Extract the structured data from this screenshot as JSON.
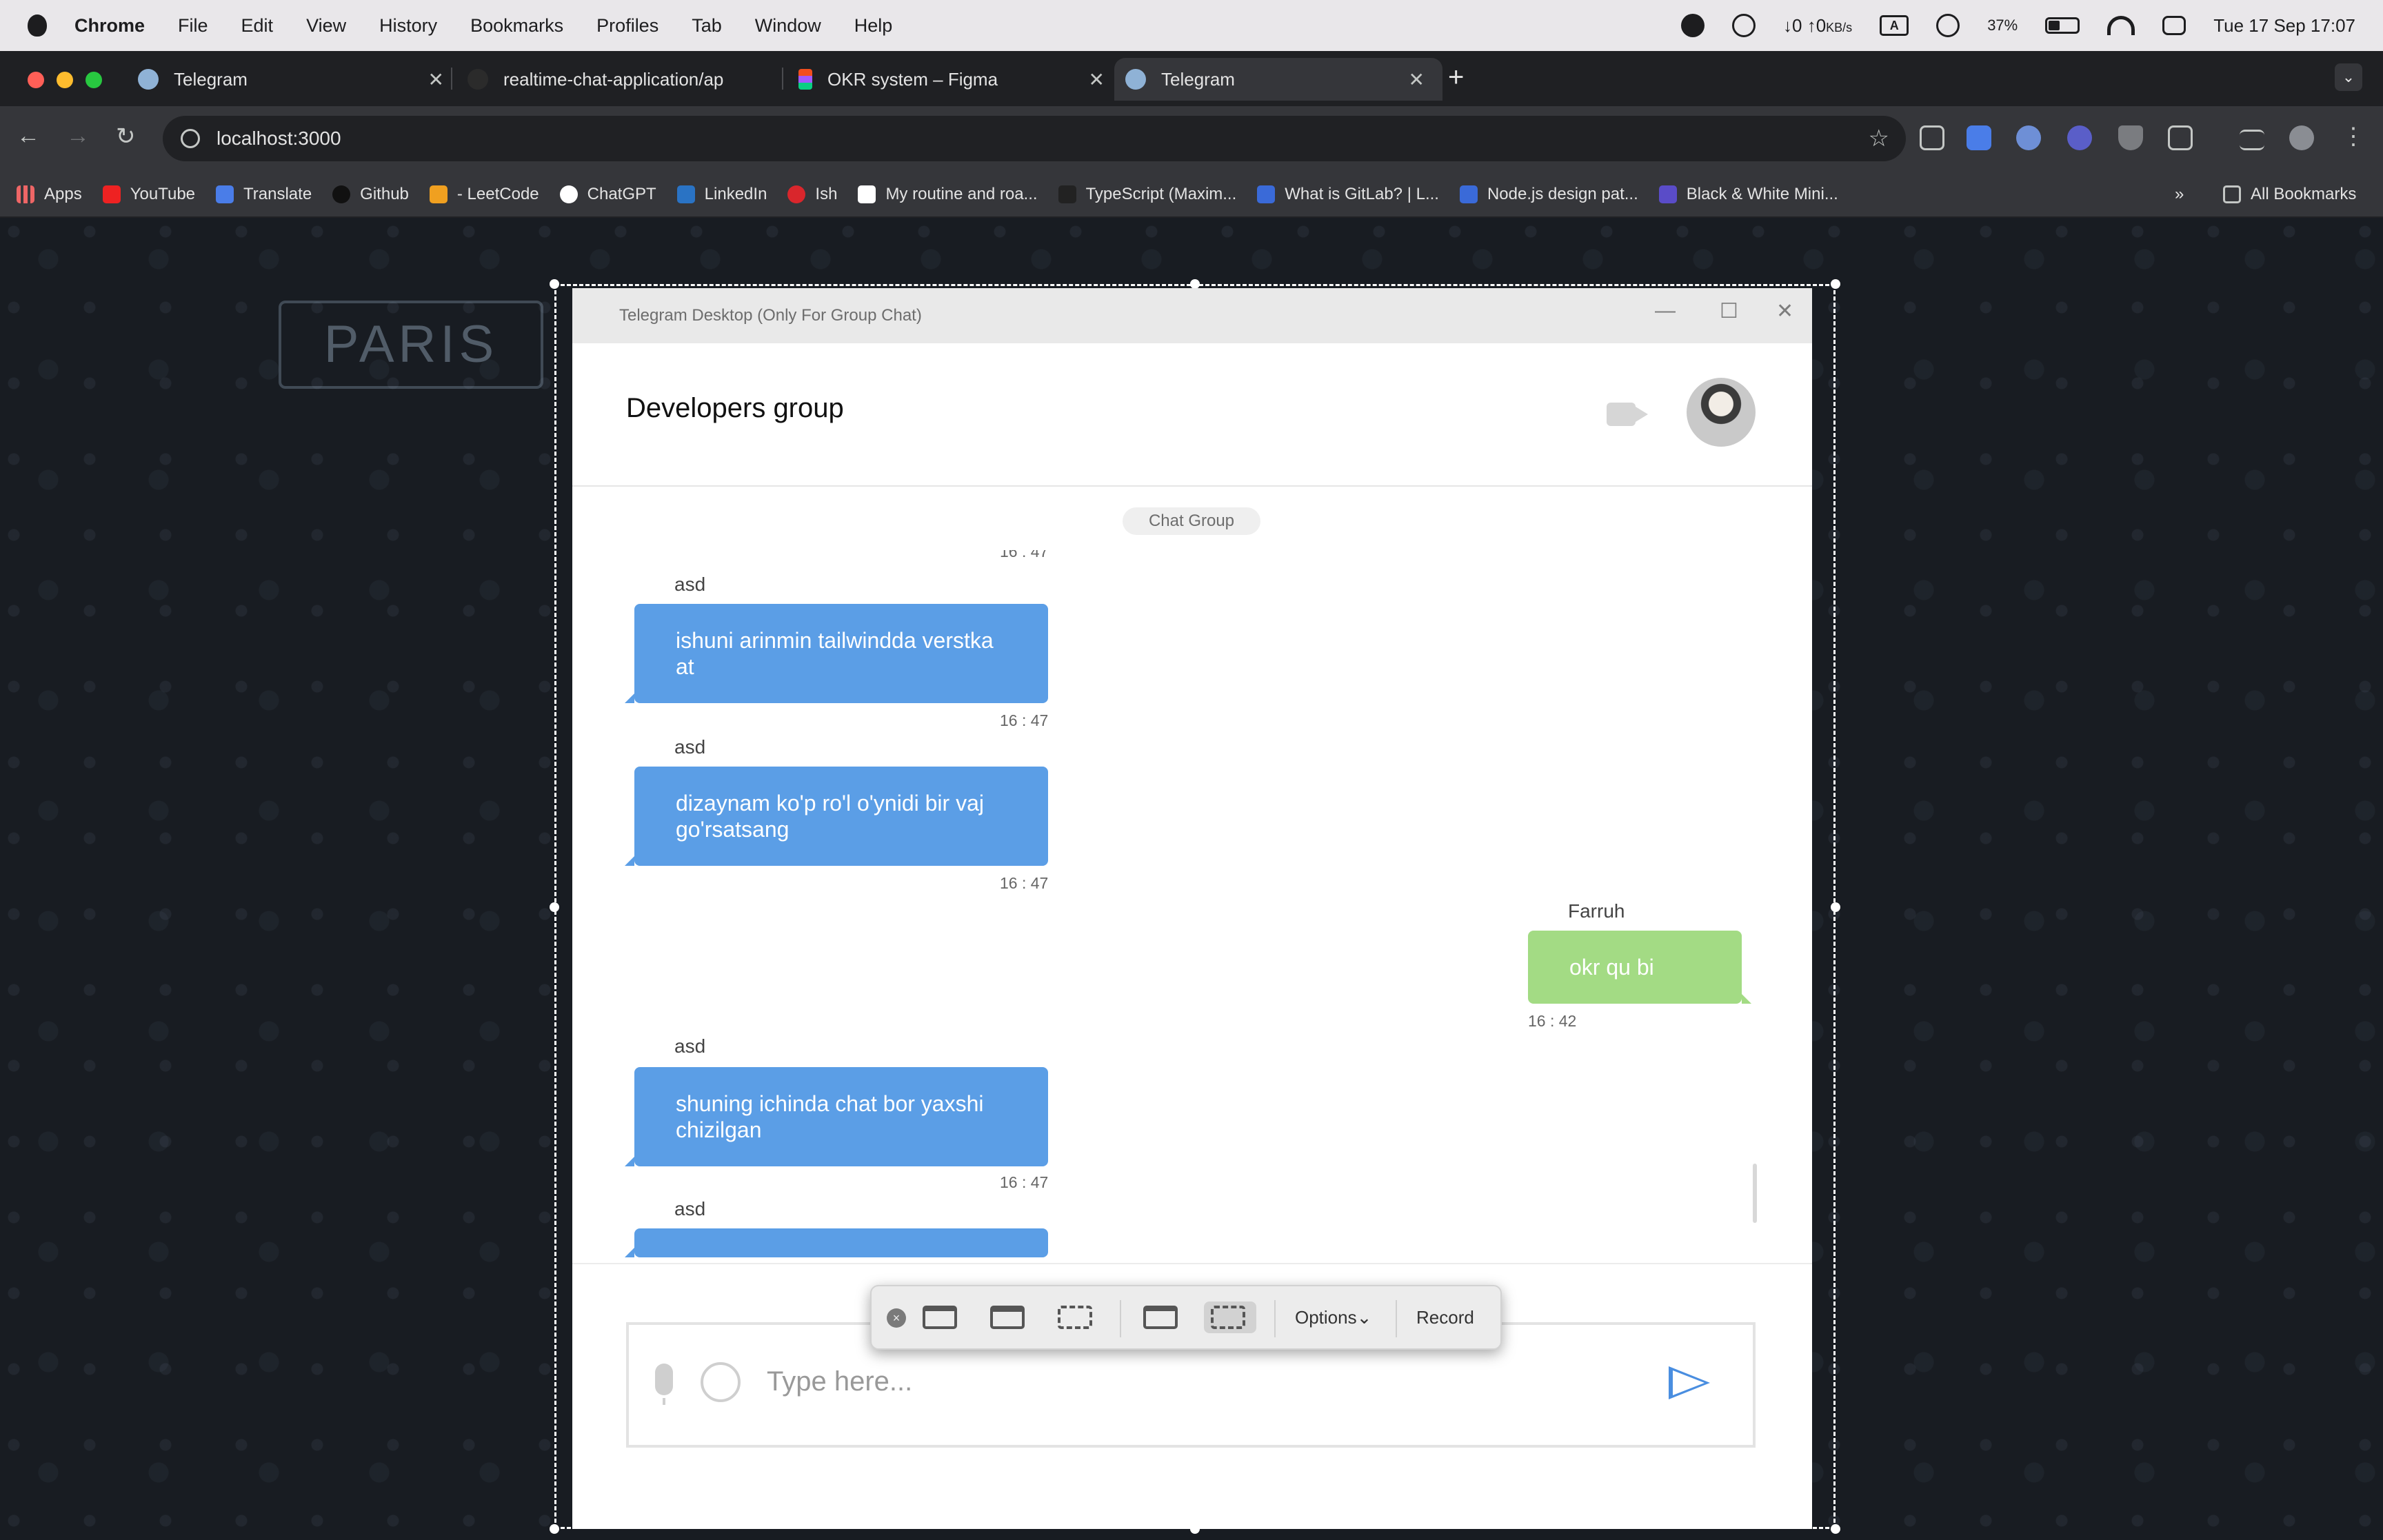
{
  "menubar": {
    "app": "Chrome",
    "items": [
      "File",
      "Edit",
      "View",
      "History",
      "Bookmarks",
      "Profiles",
      "Tab",
      "Window",
      "Help"
    ],
    "network": "↓0 ↑0",
    "network_unit": "KB/s",
    "input_source": "A",
    "battery": "37%",
    "datetime": "Tue 17 Sep  17:07"
  },
  "tabs": [
    {
      "title": "Telegram",
      "active": false
    },
    {
      "title": "realtime-chat-application/ap",
      "active": false
    },
    {
      "title": "OKR system – Figma",
      "active": false
    },
    {
      "title": "Telegram",
      "active": true
    }
  ],
  "toolbar": {
    "url": "localhost:3000",
    "new_tab": "+",
    "tab_menu": "⌄"
  },
  "bookmarks": {
    "items": [
      "Apps",
      "YouTube",
      "Translate",
      "Github",
      "- LeetCode",
      "ChatGPT",
      "LinkedIn",
      "Ish",
      "My routine and roa...",
      "TypeScript (Maxim...",
      "What is GitLab? | L...",
      "Node.js design pat...",
      "Black & White Mini..."
    ],
    "overflow": "»",
    "all": "All Bookmarks"
  },
  "telegram": {
    "window_title": "Telegram Desktop (Only For Group Chat)",
    "minimize": "—",
    "maximize": "☐",
    "close": "✕",
    "chat_name": "Developers group",
    "group_badge": "Chat Group",
    "top_time": "16 : 47",
    "messages": [
      {
        "sender": "asd",
        "text": "ishuni arinmin tailwindda verstka at",
        "time": "16 : 47",
        "outgoing": false
      },
      {
        "sender": "asd",
        "text": "dizaynam ko'p ro'l o'ynidi bir vaj go'rsatsang",
        "time": "16 : 47",
        "outgoing": false
      },
      {
        "sender": "Farruh",
        "text": "okr qu bi",
        "time": "16 : 42",
        "outgoing": true
      },
      {
        "sender": "asd",
        "text": "shuning ichinda chat bor yaxshi chizilgan",
        "time": "16 : 47",
        "outgoing": false
      },
      {
        "sender": "asd",
        "text": "",
        "time": "",
        "outgoing": false
      }
    ],
    "input_placeholder": "Type here..."
  },
  "capture_toolbar": {
    "close": "×",
    "options": "Options⌄",
    "record": "Record"
  },
  "background_labels": {
    "paris": "PARIS"
  },
  "colors": {
    "incoming_bubble": "#5b9ee6",
    "outgoing_bubble": "#a3db84",
    "send_icon": "#4a8ee0"
  }
}
